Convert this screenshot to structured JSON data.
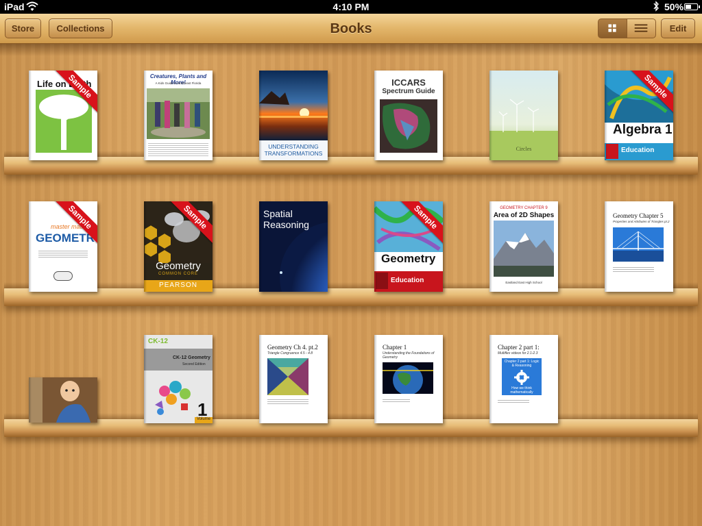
{
  "status_bar": {
    "device": "iPad",
    "time": "4:10 PM",
    "battery_percent": "50%",
    "battery_level": 0.5
  },
  "toolbar": {
    "store_label": "Store",
    "collections_label": "Collections",
    "title": "Books",
    "edit_label": "Edit",
    "view_mode": "grid"
  },
  "sample_label": "Sample",
  "books": {
    "life_on_earth": {
      "title": "Life on Earth",
      "sample": true
    },
    "creatures": {
      "title": "Creatures, Plants and More!",
      "subtitle": "A Kids Guide to Northeast Florida"
    },
    "transformations": {
      "title": "UNDERSTANDING TRANSFORMATIONS"
    },
    "iccars": {
      "title": "ICCARS",
      "subtitle": "Spectrum Guide"
    },
    "circles": {
      "title": "Circles"
    },
    "algebra1": {
      "title": "Algebra 1",
      "publisher": "Education",
      "sample": true
    },
    "master_math": {
      "kicker": "master math",
      "title": "GEOMETRY",
      "sample": true
    },
    "pearson_geometry": {
      "title": "Geometry",
      "subtitle": "COMMON CORE",
      "publisher": "PEARSON",
      "sample": true
    },
    "spatial": {
      "title": "Spatial Reasoning"
    },
    "mcgraw_geometry": {
      "title": "Geometry",
      "publisher": "Education",
      "sample": true
    },
    "area2d": {
      "kicker": "GEOMETRY CHAPTER 9",
      "title": "Area of 2D Shapes",
      "footer": "Eastland East High School"
    },
    "geo_ch5": {
      "title": "Geometry Chapter 5",
      "subtitle": "Properties and Attributes of Triangles pt.2"
    },
    "ck12": {
      "brand": "CK-12",
      "title": "CK-12 Geometry",
      "subtitle": "Second Edition",
      "volume": "1",
      "volume_label": "Volume"
    },
    "geo_ch4": {
      "title": "Geometry Ch 4. pt.2",
      "subtitle": "Triangle Congruence 4.5 - 4.8"
    },
    "chapter1": {
      "title": "Chapter 1",
      "subtitle": "Understanding the Foundations of Geometry"
    },
    "chapter2": {
      "title": "Chapter 2 part 1:",
      "subtitle": "Multiflex videos for 2.1-2.3",
      "inner_title": "Chapter 2 part 1: Logic & Reasoning",
      "inner_caption": "How we think mathematically"
    }
  },
  "colors": {
    "toolbar_text": "#5b3713",
    "sample_ribbon": "#d8121b",
    "mcgraw_red": "#c8151d"
  }
}
